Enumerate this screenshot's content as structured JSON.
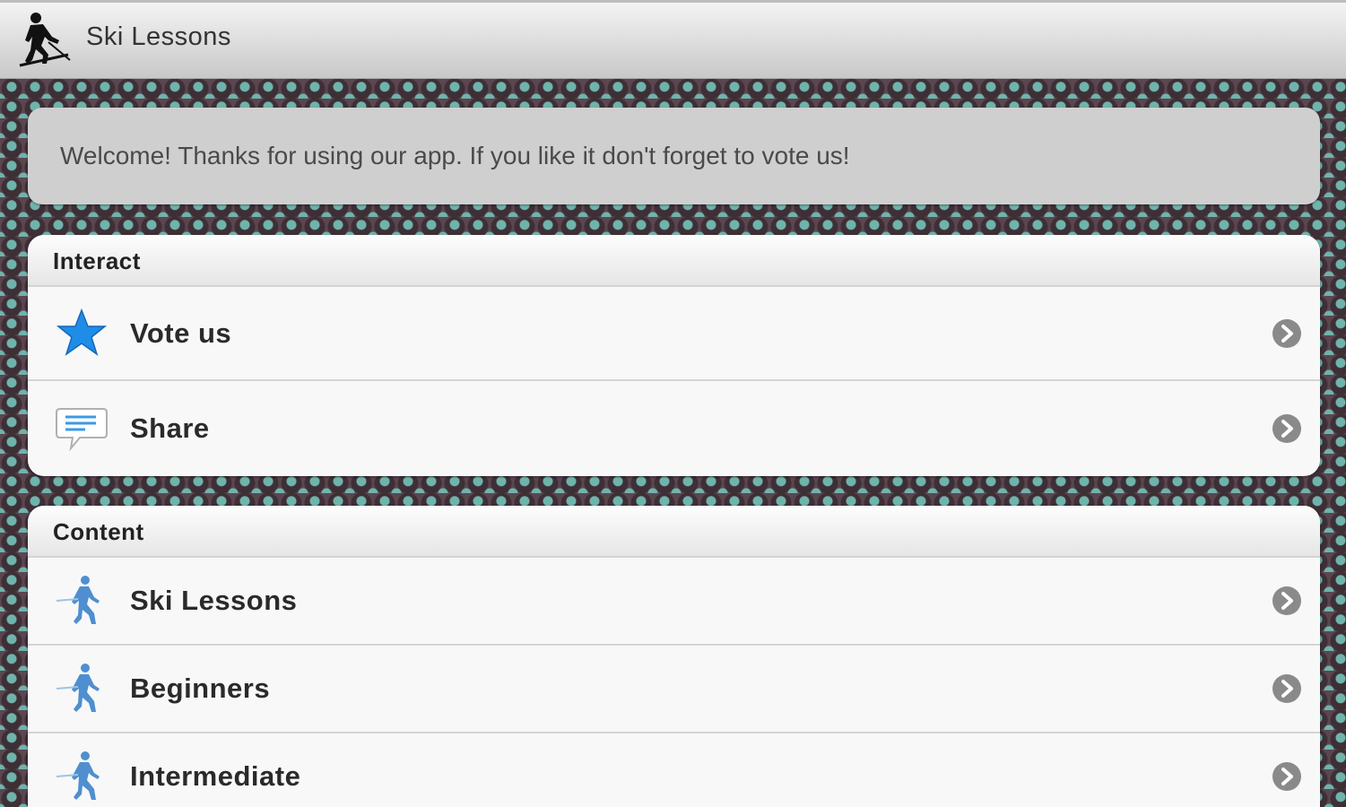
{
  "app": {
    "title": "Ski Lessons"
  },
  "welcome": {
    "text": "Welcome! Thanks for using our app. If you like it don't forget to vote us!"
  },
  "groups": [
    {
      "header": "Interact",
      "items": [
        {
          "label": "Vote us",
          "icon": "star-icon"
        },
        {
          "label": "Share",
          "icon": "speech-bubble-icon"
        }
      ]
    },
    {
      "header": "Content",
      "items": [
        {
          "label": "Ski Lessons",
          "icon": "skier-icon"
        },
        {
          "label": "Beginners",
          "icon": "skier-icon"
        },
        {
          "label": "Intermediate",
          "icon": "skier-icon"
        }
      ]
    }
  ],
  "colors": {
    "star": "#1f8de8",
    "chevron": "#8a8a8a",
    "skier": "#4f8fd0"
  }
}
